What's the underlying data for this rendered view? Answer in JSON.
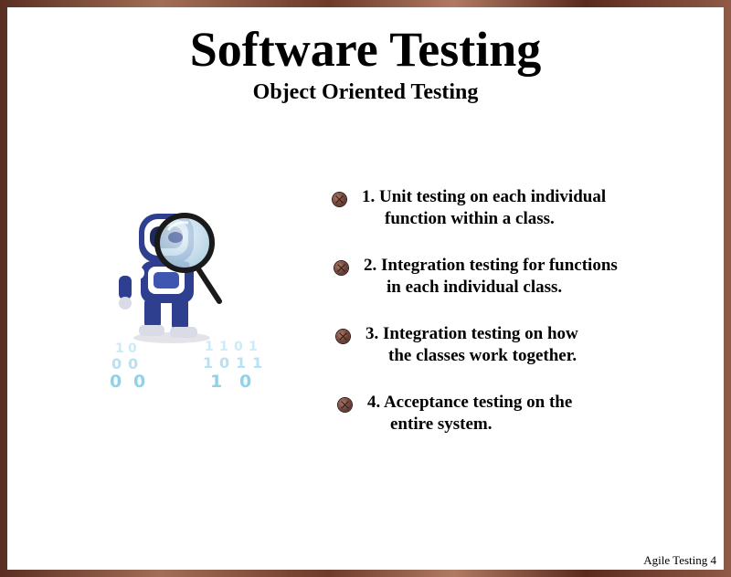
{
  "slide": {
    "title": "Software Testing",
    "subtitle": "Object Oriented Testing",
    "footer": "Agile Testing 4"
  },
  "illustration": {
    "icon": "robot-magnifier-icon",
    "binary_digits": [
      "1",
      "0",
      "1",
      "1",
      "0",
      "1",
      "0",
      "0",
      "1",
      "0",
      "1",
      "1",
      "0",
      "0",
      "1",
      "0"
    ]
  },
  "bullets": [
    {
      "line1": "1. Unit testing on each individual",
      "line2": "function within a class."
    },
    {
      "line1": "2. Integration testing for functions",
      "line2": "in each individual class."
    },
    {
      "line1": "3. Integration testing on how",
      "line2": "the classes work together."
    },
    {
      "line1": "4. Acceptance testing on the",
      "line2": "entire system."
    }
  ],
  "colors": {
    "frame": "#7a4434",
    "bullet": "#7a4a3e",
    "robot_blue": "#2d3f8e",
    "binary": "#8fd2ea"
  }
}
